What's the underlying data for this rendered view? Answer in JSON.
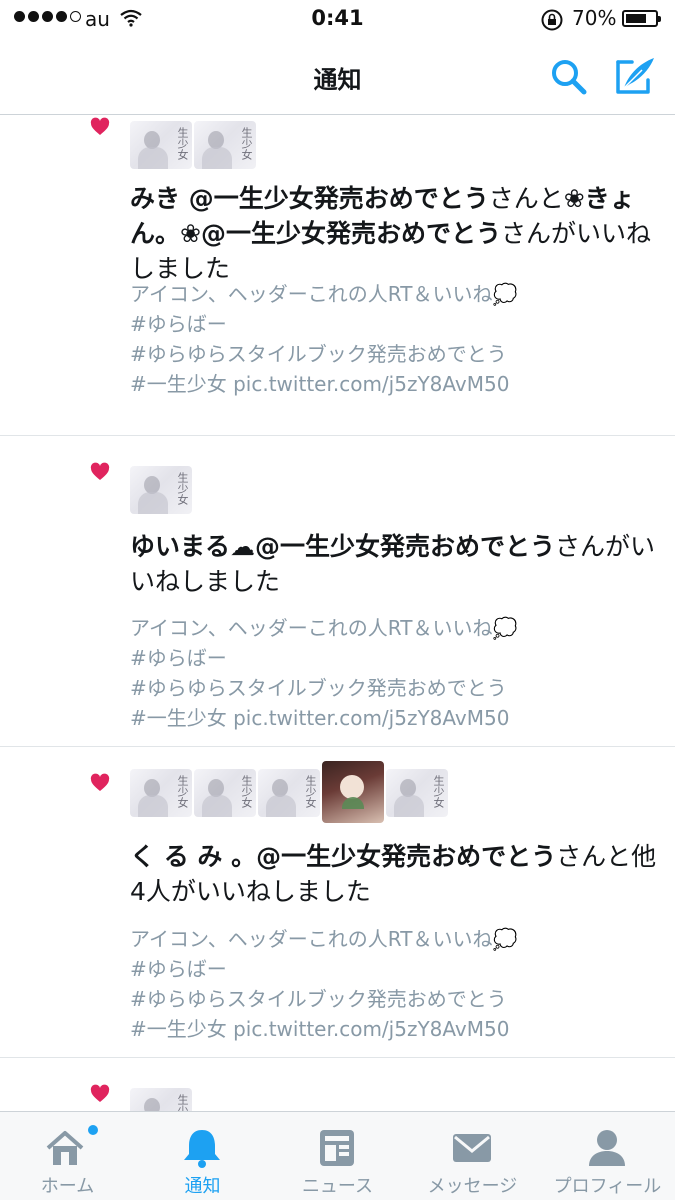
{
  "status_bar": {
    "carrier": "au",
    "time": "0:41",
    "battery": "70%",
    "battery_level": 0.7
  },
  "header": {
    "title": "通知"
  },
  "notifications": [
    {
      "summary_parts": [
        {
          "text": "みき @一生少女発売おめでとう",
          "bold": true
        },
        {
          "text": "さんと",
          "bold": false
        },
        {
          "text": "❀きょん。❀@一生少女発売おめでとう",
          "bold": true
        },
        {
          "text": "さんがいいねしました",
          "bold": false
        }
      ],
      "tweet_lines": [
        "アイコン、ヘッダーこれの人RT＆いいね💭",
        "#ゆらばー",
        "#ゆらゆらスタイルブック発売おめでとう",
        "#一生少女 pic.twitter.com/j5zY8AvM50"
      ]
    },
    {
      "summary_parts": [
        {
          "text": "ゆいまる☁@一生少女発売おめでとう",
          "bold": true
        },
        {
          "text": "さんがいいねしました",
          "bold": false
        }
      ],
      "tweet_lines": [
        "アイコン、ヘッダーこれの人RT＆いいね💭",
        "#ゆらばー",
        "#ゆらゆらスタイルブック発売おめでとう",
        "#一生少女 pic.twitter.com/j5zY8AvM50"
      ]
    },
    {
      "summary_parts": [
        {
          "text": "く る み 。@一生少女発売おめでとう",
          "bold": true
        },
        {
          "text": "さんと他4人がいいねしました",
          "bold": false
        }
      ],
      "tweet_lines": [
        "アイコン、ヘッダーこれの人RT＆いいね💭",
        "#ゆらばー",
        "#ゆらゆらスタイルブック発売おめでとう",
        "#一生少女 pic.twitter.com/j5zY8AvM50"
      ]
    }
  ],
  "avatar_glyph": "生少女",
  "tabs": [
    {
      "label": "ホーム",
      "icon": "home-icon"
    },
    {
      "label": "通知",
      "icon": "bell-icon"
    },
    {
      "label": "ニュース",
      "icon": "news-icon"
    },
    {
      "label": "メッセージ",
      "icon": "envelope-icon"
    },
    {
      "label": "プロフィール",
      "icon": "person-icon"
    }
  ],
  "colors": {
    "accent": "#1da1f2",
    "heart": "#e0245e",
    "muted": "#8899a6",
    "text": "#14171a"
  }
}
